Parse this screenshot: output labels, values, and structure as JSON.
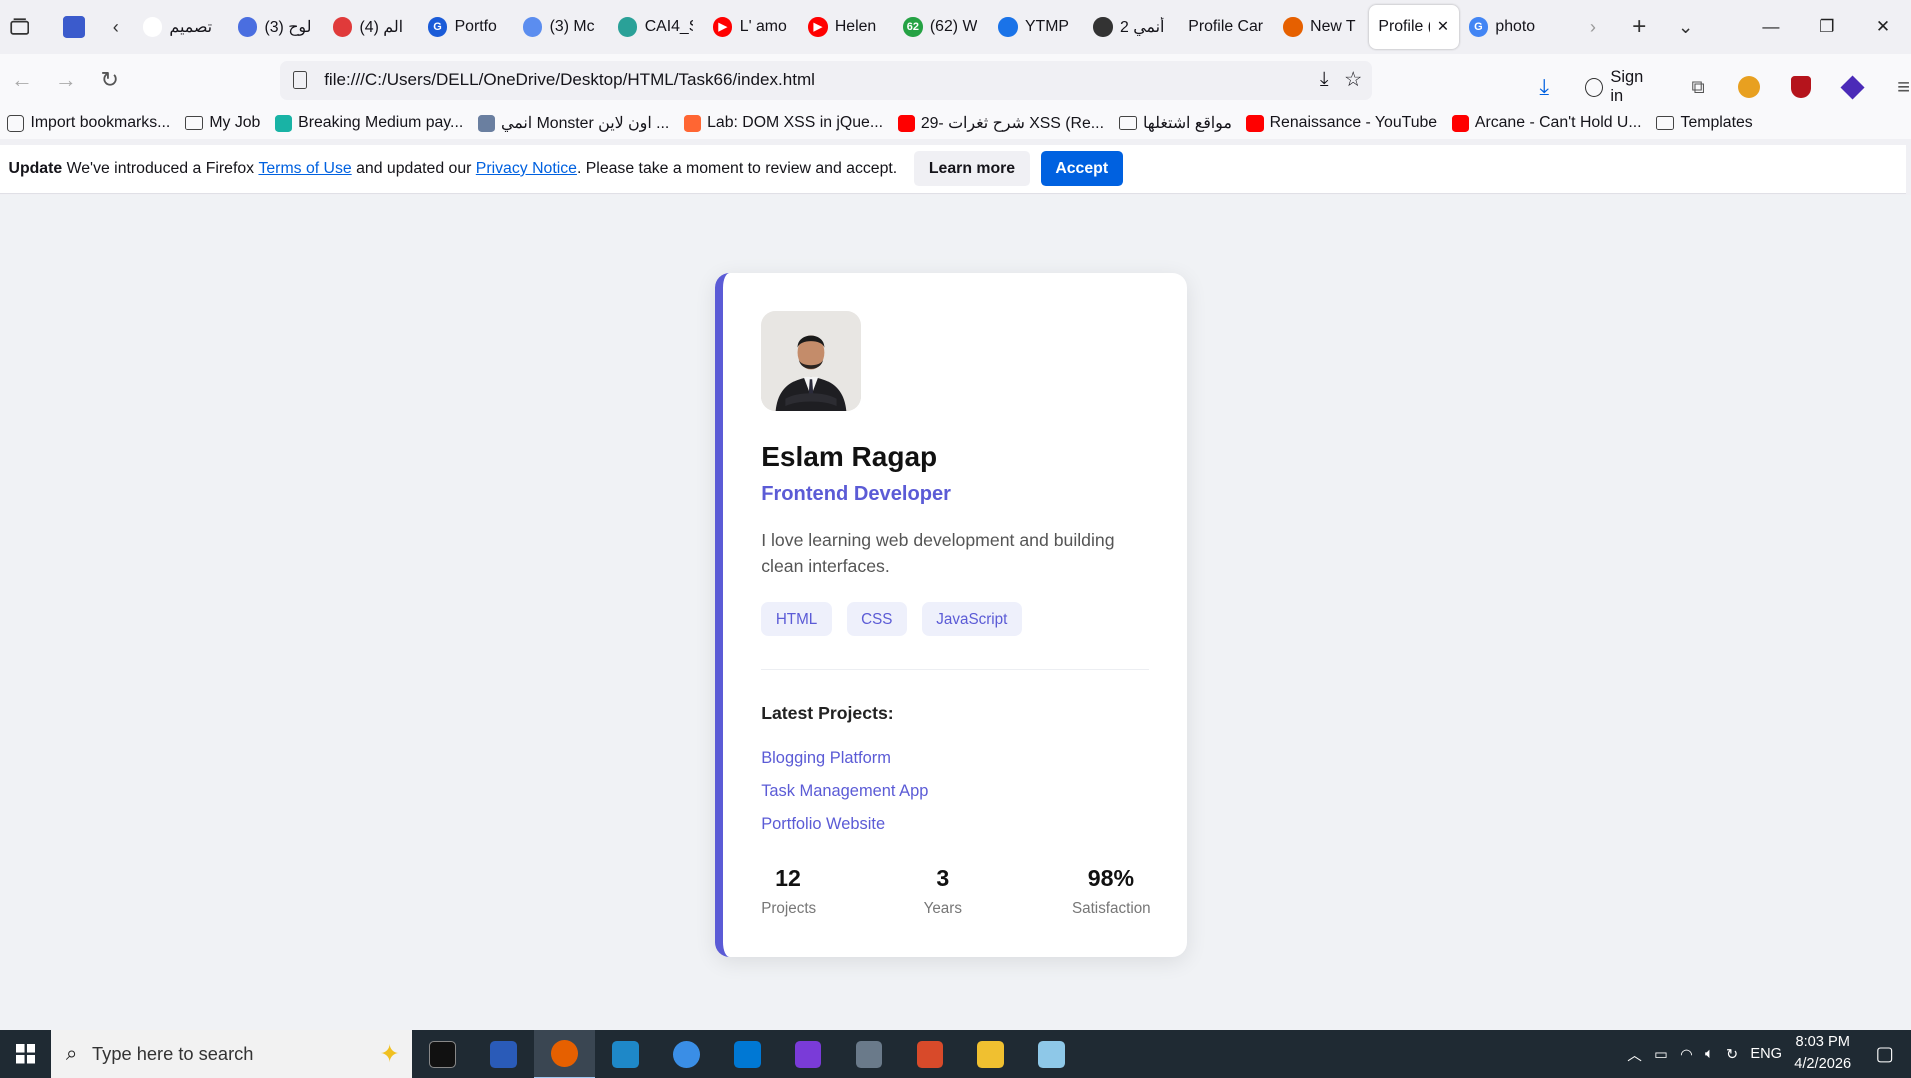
{
  "browser": {
    "tabs": [
      {
        "title": "تصميم",
        "color": "#fff",
        "text": ""
      },
      {
        "title": "(3) لوح",
        "color": "#4a6ee0",
        "text": ""
      },
      {
        "title": "(4) الم",
        "color": "#e03a3a",
        "text": ""
      },
      {
        "title": "Portfo",
        "color": "#1a5bd8",
        "text": "G"
      },
      {
        "title": "(3) Mc",
        "color": "#5b8def",
        "text": ""
      },
      {
        "title": "CAI4_S",
        "color": "#2aa198",
        "text": ""
      },
      {
        "title": "L' amo",
        "color": "#ff0000",
        "text": "▶"
      },
      {
        "title": "Helen",
        "color": "#ff0000",
        "text": "▶"
      },
      {
        "title": "(62) W",
        "color": "#25a244",
        "text": "62"
      },
      {
        "title": "YTMP",
        "color": "#1a73e8",
        "text": ""
      },
      {
        "title": "أنمي 2",
        "color": "#333",
        "text": ""
      },
      {
        "title": "Profile Car",
        "color": "",
        "text": ""
      },
      {
        "title": "New T",
        "color": "#e66000",
        "text": ""
      },
      {
        "title": "Profile (",
        "color": "",
        "text": ""
      },
      {
        "title": "photo",
        "color": "#4285f4",
        "text": "G"
      }
    ],
    "url": "file:///C:/Users/DELL/OneDrive/Desktop/HTML/Task66/index.html",
    "sign_in": "Sign in",
    "bookmarks": [
      {
        "label": "Import bookmarks...",
        "type": "import"
      },
      {
        "label": "My Job",
        "type": "folder"
      },
      {
        "label": "Breaking Medium pay...",
        "type": "site",
        "color": "#19b3a5"
      },
      {
        "label": "انمي Monster اون لاين ...",
        "type": "site",
        "color": "#6a7fa0"
      },
      {
        "label": "Lab: DOM XSS in jQue...",
        "type": "site",
        "color": "#ff6633"
      },
      {
        "label": "29- شرح ثغرات XSS (Re...",
        "type": "site",
        "color": "#ff0000"
      },
      {
        "label": "مواقع اشتغلها",
        "type": "folder"
      },
      {
        "label": "Renaissance - YouTube",
        "type": "site",
        "color": "#ff0000"
      },
      {
        "label": "Arcane - Can't Hold U...",
        "type": "site",
        "color": "#ff0000"
      },
      {
        "label": "Templates",
        "type": "folder"
      }
    ],
    "notice": {
      "bold": "Update",
      "text1": " We've introduced a Firefox ",
      "link1": "Terms of Use",
      "text2": " and updated our ",
      "link2": "Privacy Notice",
      "text3": ". Please take a moment to review and accept.",
      "learn_more": "Learn more",
      "accept": "Accept"
    }
  },
  "card": {
    "name": "Eslam Ragap",
    "role": "Frontend Developer",
    "bio": "I love learning web development and building clean interfaces.",
    "skills": [
      "HTML",
      "CSS",
      "JavaScript"
    ],
    "projects_heading": "Latest Projects:",
    "projects": [
      "Blogging Platform",
      "Task Management App",
      "Portfolio Website"
    ],
    "stats": [
      {
        "value": "12",
        "label": "Projects"
      },
      {
        "value": "3",
        "label": "Years"
      },
      {
        "value": "98%",
        "label": "Satisfaction"
      }
    ],
    "accent": "#5b5bd6"
  },
  "taskbar": {
    "search_placeholder": "Type here to search",
    "lang": "ENG",
    "time": "8:03 PM",
    "date": "4/2/2026"
  }
}
